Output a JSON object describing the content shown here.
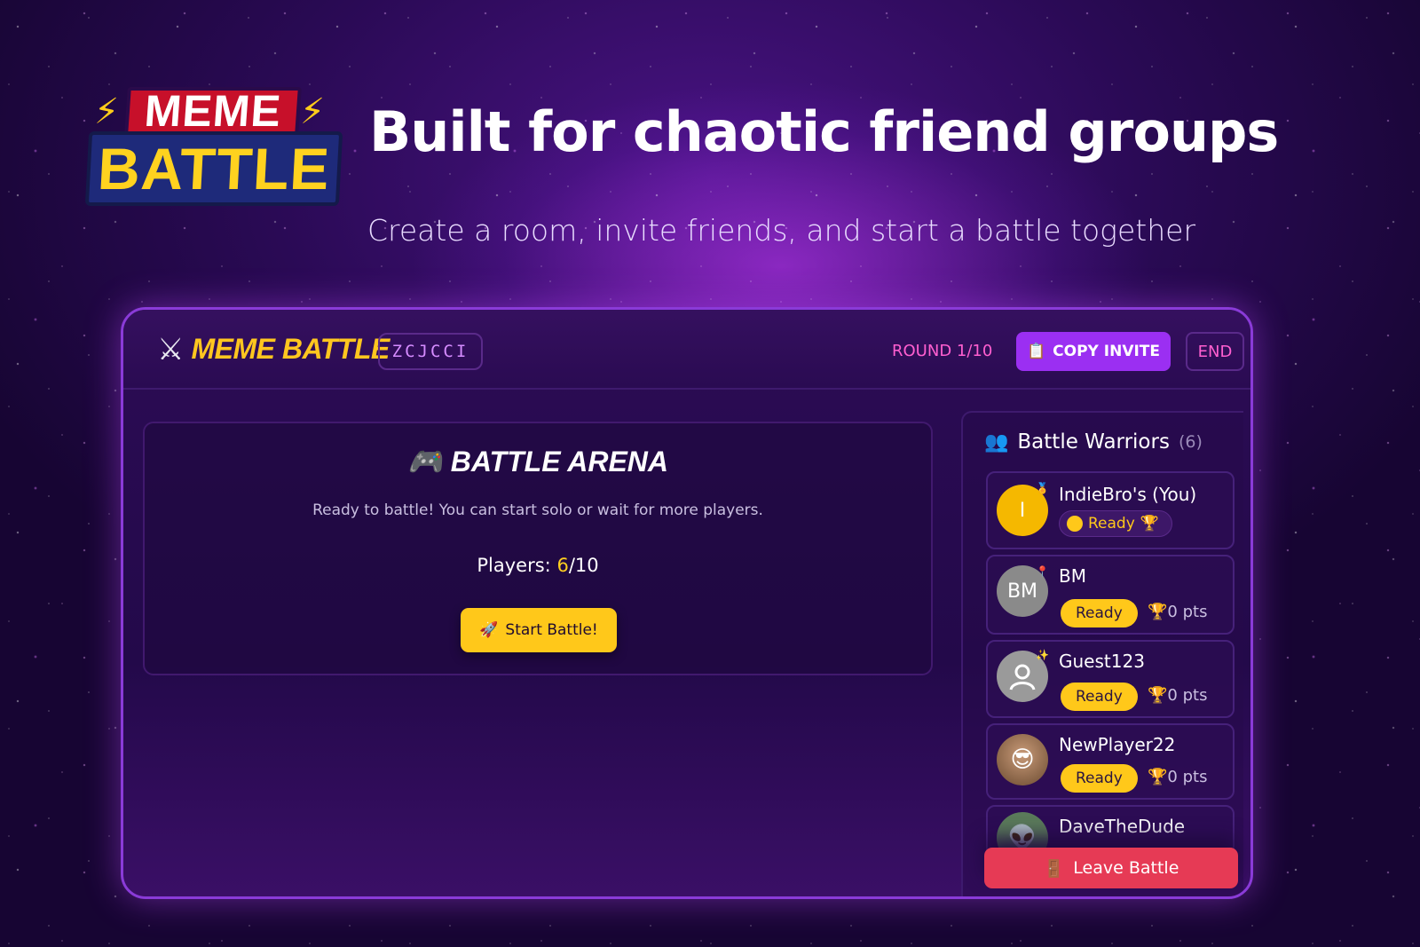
{
  "logo": {
    "line1": "MEME",
    "line2": "BATTLE"
  },
  "hero": {
    "headline": "Built for chaotic friend groups",
    "subline": "Create a room, invite friends, and start a battle together"
  },
  "topbar": {
    "brand": "MEME BATTLE",
    "room_code": "ZCJCCI",
    "round": "ROUND 1/10",
    "copy_invite": "COPY INVITE",
    "end": "END"
  },
  "arena": {
    "title": "BATTLE ARENA",
    "description": "Ready to battle! You can start solo or wait for more players.",
    "players_label": "Players: ",
    "players_count": "6",
    "players_max": "/10",
    "start_button": "Start Battle!"
  },
  "sidebar": {
    "title": "Battle Warriors",
    "count": "(6)",
    "players": [
      {
        "name": "IndieBro's (You)",
        "initial": "I",
        "status": "Ready",
        "avatar_color": "#f5b800"
      },
      {
        "name": "BM",
        "initial": "BM",
        "status": "Ready",
        "points": "0 pts",
        "avatar_color": "#8a8a8a"
      },
      {
        "name": "Guest123",
        "status": "Ready",
        "points": "0 pts",
        "avatar_color": "#9a9a9a"
      },
      {
        "name": "NewPlayer22",
        "status": "Ready",
        "points": "0 pts",
        "avatar_color": "#8a6a4a"
      },
      {
        "name": "DaveTheDude",
        "avatar_color": "#6a8a6a"
      }
    ],
    "leave_button": "Leave Battle"
  },
  "colors": {
    "accent_yellow": "#ffc81a",
    "accent_purple": "#9b2ff2",
    "accent_pink": "#ff5fd0",
    "danger_red": "#e63a55"
  }
}
